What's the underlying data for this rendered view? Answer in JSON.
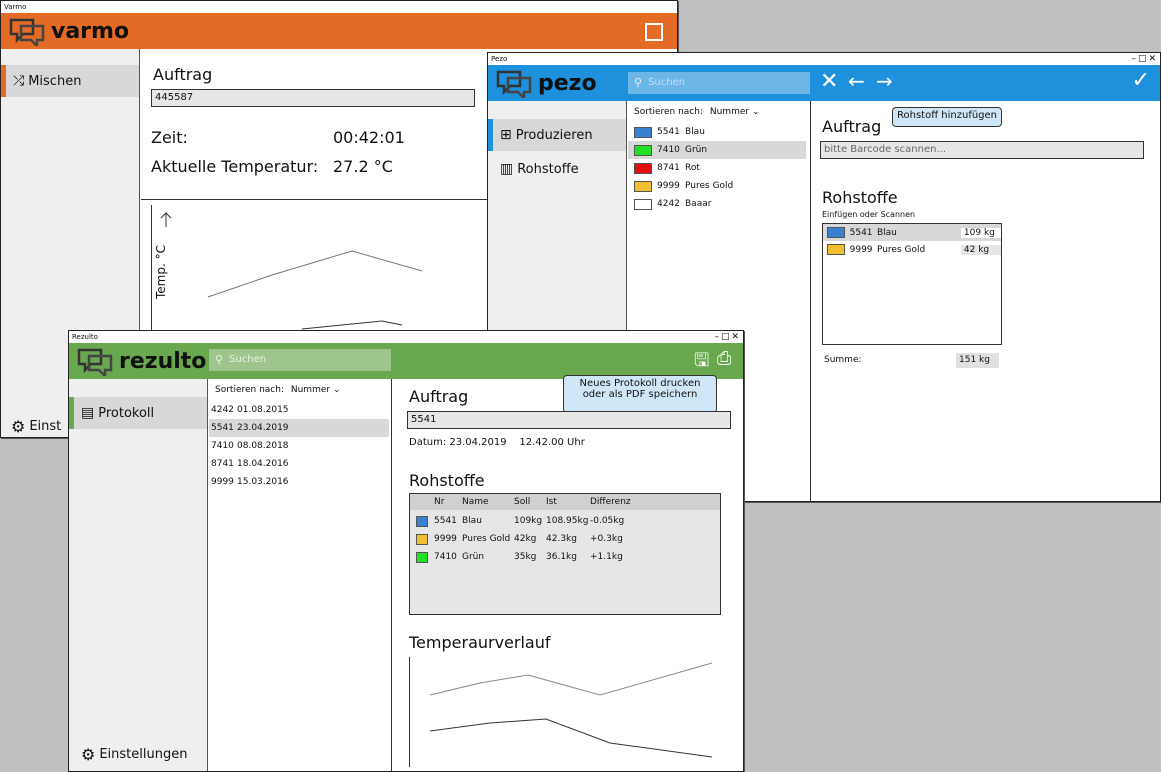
{
  "colors": {
    "varmo": "#e46b26",
    "pezo": "#1e90dc",
    "rezulto": "#6aa84f"
  },
  "varmo": {
    "title": "Varmo",
    "logo": "varmo",
    "nav": [
      {
        "label": "Mischen",
        "icon": "shuffle-icon"
      }
    ],
    "settings": "Einst",
    "order_label": "Auftrag",
    "order_value": "445587",
    "time_label": "Zeit:",
    "time_value": "00:42:01",
    "temp_label": "Aktuelle Temperatur:",
    "temp_value": "27.2 °C",
    "chart_ylabel": "Temp. °C"
  },
  "pezo": {
    "title": "Pezo",
    "logo": "pezo",
    "search_placeholder": "Suchen",
    "nav": [
      {
        "label": "Produzieren",
        "icon": "grid-icon"
      },
      {
        "label": "Rohstoffe",
        "icon": "books-icon"
      }
    ],
    "sort_label": "Sortieren nach:",
    "sort_value": "Nummer",
    "materials": [
      {
        "nr": "5541",
        "name": "Blau",
        "color": "#3b7fd1"
      },
      {
        "nr": "7410",
        "name": "Grün",
        "color": "#22e022"
      },
      {
        "nr": "8741",
        "name": "Rot",
        "color": "#e01010"
      },
      {
        "nr": "9999",
        "name": "Pures Gold",
        "color": "#f0c030"
      },
      {
        "nr": "4242",
        "name": "Baaar",
        "color": "#ffffff"
      }
    ],
    "tooltip": "Rohstoff hinzufügen",
    "order_label": "Auftrag",
    "barcode_placeholder": "bitte Barcode scannen...",
    "materials_header": "Rohstoffe",
    "materials_sub": "Einfügen oder Scannen",
    "added": [
      {
        "nr": "5541",
        "name": "Blau",
        "amount": "109 kg",
        "color": "#3b7fd1"
      },
      {
        "nr": "9999",
        "name": "Pures Gold",
        "amount": "42 kg",
        "color": "#f0c030"
      }
    ],
    "sum_label": "Summe:",
    "sum_value": "151 kg"
  },
  "rezulto": {
    "title": "Rezulto",
    "logo": "rezulto",
    "search_placeholder": "Suchen",
    "nav": [
      {
        "label": "Protokoll",
        "icon": "protocol-icon"
      }
    ],
    "settings": "Einstellungen",
    "sort_label": "Sortieren nach:",
    "sort_value": "Nummer",
    "orders": [
      {
        "nr": "4242",
        "date": "01.08.2015"
      },
      {
        "nr": "5541",
        "date": "23.04.2019"
      },
      {
        "nr": "7410",
        "date": "08.08.2018"
      },
      {
        "nr": "8741",
        "date": "18.04.2016"
      },
      {
        "nr": "9999",
        "date": "15.03.2016"
      }
    ],
    "tooltip": "Neues Protokoll drucken oder als PDF speichern",
    "order_label": "Auftrag",
    "order_value": "5541",
    "date_line": "Datum: 23.04.2019    12.42.00 Uhr",
    "materials_header": "Rohstoffe",
    "table_headers": [
      "Nr",
      "Name",
      "Soll",
      "Ist",
      "Differenz"
    ],
    "table_rows": [
      {
        "nr": "5541",
        "name": "Blau",
        "soll": "109kg",
        "ist": "108.95kg",
        "diff": "-0.05kg",
        "color": "#3b7fd1"
      },
      {
        "nr": "9999",
        "name": "Pures Gold",
        "soll": "42kg",
        "ist": "42.3kg",
        "diff": "+0.3kg",
        "color": "#f0c030"
      },
      {
        "nr": "7410",
        "name": "Grün",
        "soll": "35kg",
        "ist": "36.1kg",
        "diff": "+1.1kg",
        "color": "#22e022"
      }
    ],
    "temp_header": "Temperaurverlauf"
  }
}
